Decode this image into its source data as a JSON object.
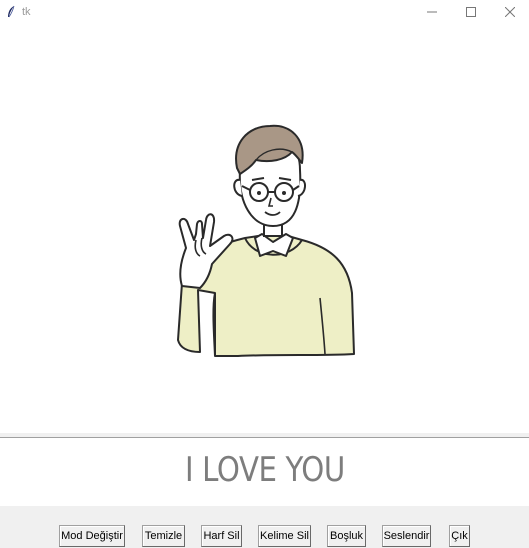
{
  "window": {
    "title": "tk",
    "app_icon": "feather-icon"
  },
  "window_controls": [
    "minimize-icon",
    "maximize-icon",
    "close-icon"
  ],
  "illustration": {
    "subject": "person signing I love you",
    "icon": "sign-language-illustration"
  },
  "output": {
    "text": "I LOVE YOU"
  },
  "buttons": [
    {
      "label": "Mod Değiştir"
    },
    {
      "label": "Temizle"
    },
    {
      "label": "Harf Sil"
    },
    {
      "label": "Kelime Sil"
    },
    {
      "label": "Boşluk"
    },
    {
      "label": "Seslendir"
    },
    {
      "label": "Çık"
    }
  ]
}
